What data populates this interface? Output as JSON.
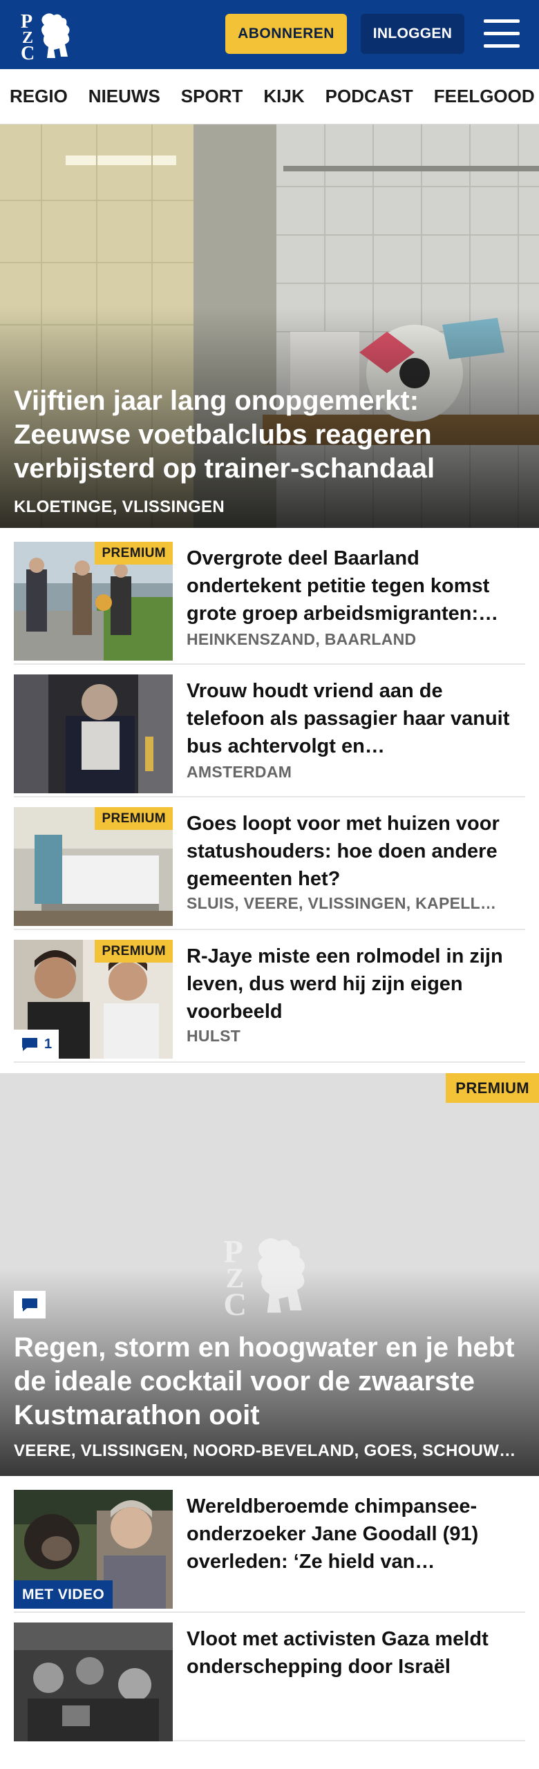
{
  "header": {
    "subscribe_label": "ABONNEREN",
    "login_label": "INLOGGEN",
    "logo_text": "PZC"
  },
  "nav": {
    "items": [
      "REGIO",
      "NIEUWS",
      "SPORT",
      "KIJK",
      "PODCAST",
      "FEELGOOD"
    ]
  },
  "hero": {
    "title": "Vijftien jaar lang onopgemerkt: Zeeuwse voetbalclubs reageren verbijsterd op trainer-schandaal",
    "location": "KLOETINGE, VLISSINGEN"
  },
  "articles": [
    {
      "title": "Overgrote deel Baarland ondertekent petitie tegen komst grote groep arbeidsmigranten:…",
      "location": "HEINKENSZAND, BAARLAND",
      "badge": "PREMIUM"
    },
    {
      "title": "Vrouw houdt vriend aan de telefoon als passagier haar vanuit bus achtervolgt en…",
      "location": "AMSTERDAM"
    },
    {
      "title": "Goes loopt voor met huizen voor statushouders: hoe doen andere gemeenten het?",
      "location": "SLUIS, VEERE, VLISSINGEN, KAPELL…",
      "badge": "PREMIUM"
    },
    {
      "title": "R-Jaye miste een rolmodel in zijn leven, dus werd hij zijn eigen voorbeeld",
      "location": "HULST",
      "badge": "PREMIUM",
      "comments": "1"
    }
  ],
  "feature": {
    "badge": "PREMIUM",
    "title": "Regen, storm en hoogwater en je hebt de ideale cocktail voor de zwaarste Kustmarathon ooit",
    "location": "VEERE, VLISSINGEN, NOORD-BEVELAND, GOES, SCHOUWE…"
  },
  "articles2": [
    {
      "title": "Wereldberoemde chimpansee-onderzoeker Jane Goodall (91) overleden: ‘Ze hield van…",
      "badge": "MET VIDEO"
    },
    {
      "title": "Vloot met activisten Gaza meldt onderschepping door Israël"
    }
  ],
  "colors": {
    "brand": "#0b3e8d",
    "accent": "#f4c236"
  }
}
